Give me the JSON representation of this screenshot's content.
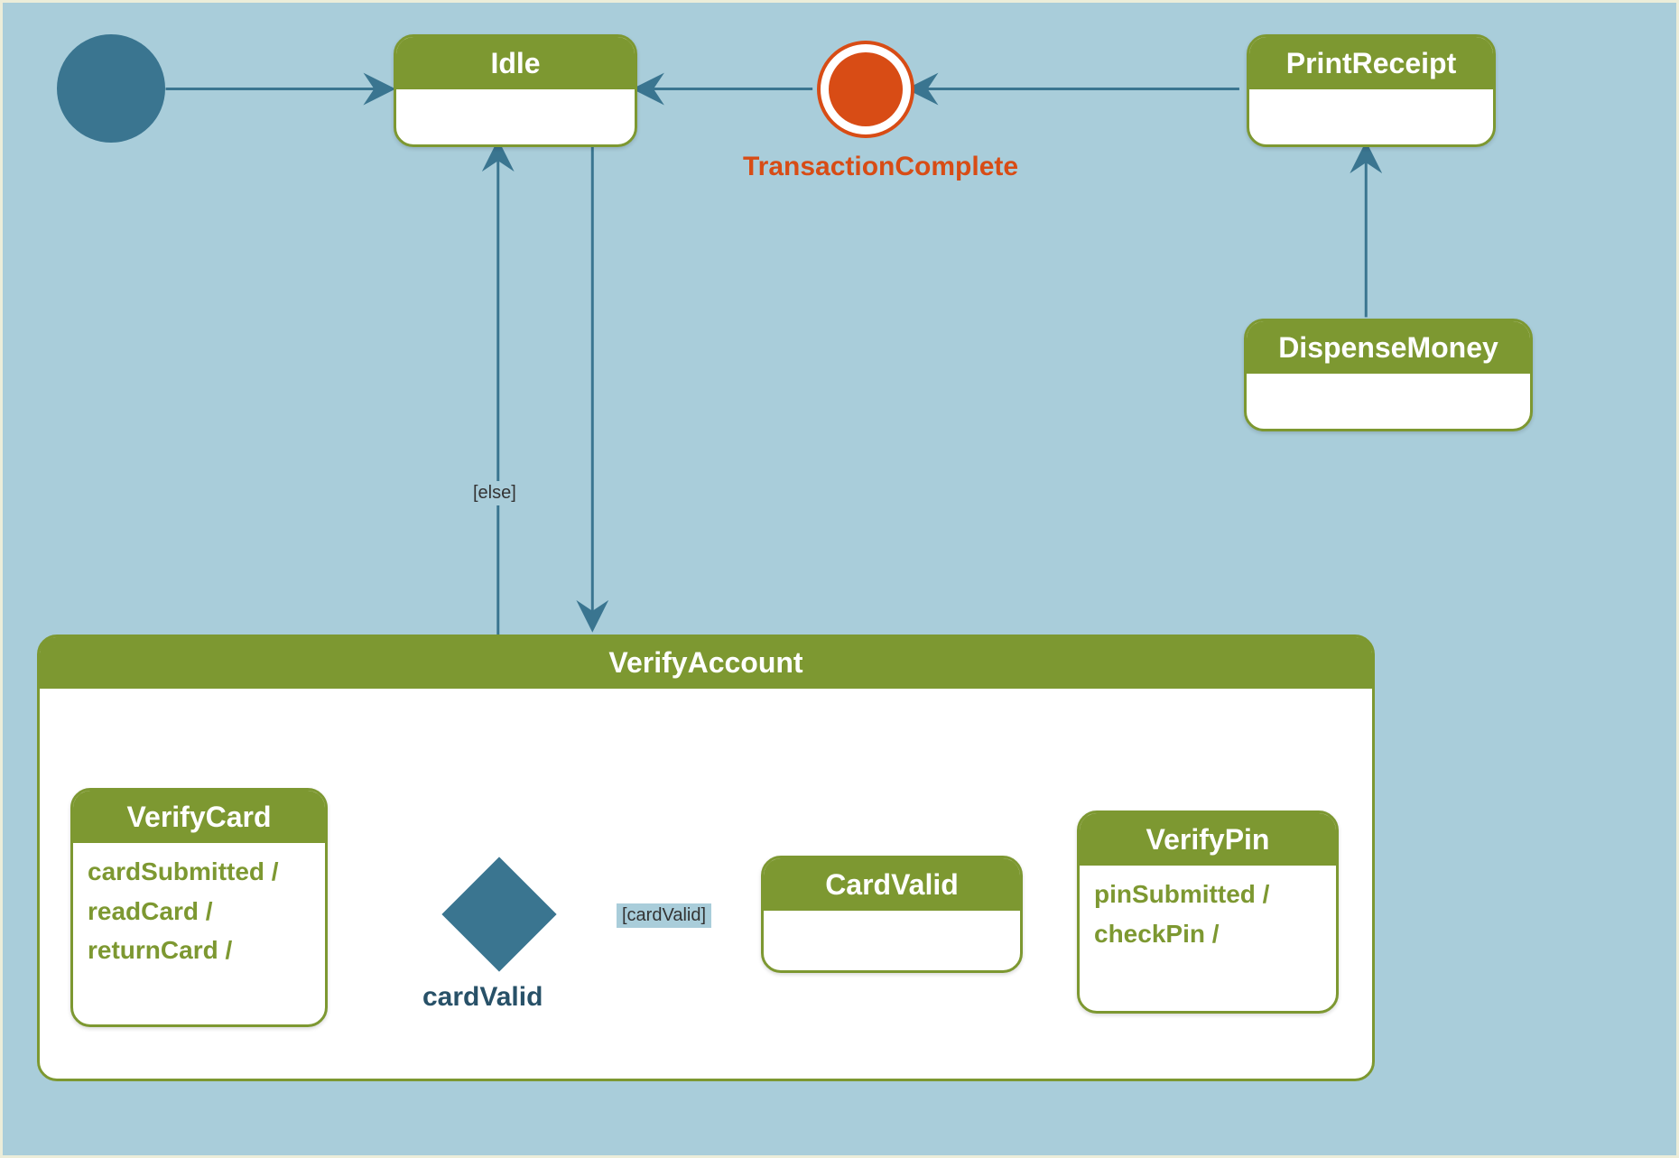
{
  "states": {
    "idle": {
      "label": "Idle"
    },
    "printReceipt": {
      "label": "PrintReceipt"
    },
    "dispenseMoney": {
      "label": "DispenseMoney"
    },
    "verifyAccount": {
      "label": "VerifyAccount"
    },
    "verifyCard": {
      "label": "VerifyCard",
      "actions": [
        "cardSubmitted /",
        "readCard /",
        "returnCard /"
      ]
    },
    "cardValid": {
      "label": "CardValid"
    },
    "verifyPin": {
      "label": "VerifyPin",
      "actions": [
        "pinSubmitted /",
        "checkPin /"
      ]
    }
  },
  "final": {
    "label": "TransactionComplete"
  },
  "decision": {
    "label": "cardValid"
  },
  "guards": {
    "else": "[else]",
    "cardValid": "[cardValid]"
  },
  "colors": {
    "stateFill": "#7d9831",
    "canvas": "#a9cdda",
    "stroke": "#3a7590",
    "final": "#d84c15"
  },
  "edges": [
    {
      "from": "initial",
      "to": "idle"
    },
    {
      "from": "idle",
      "to": "verifyAccount"
    },
    {
      "from": "decision",
      "to": "idle",
      "guard": "[else]"
    },
    {
      "from": "verifyCard",
      "to": "decision"
    },
    {
      "from": "decision",
      "to": "cardValid",
      "guard": "[cardValid]"
    },
    {
      "from": "cardValid",
      "to": "verifyPin"
    },
    {
      "from": "dispenseMoney",
      "to": "printReceipt"
    },
    {
      "from": "printReceipt",
      "to": "final"
    },
    {
      "from": "final",
      "to": "idle"
    }
  ]
}
